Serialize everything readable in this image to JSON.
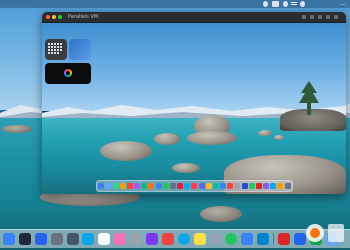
{
  "menubar": {
    "clock": "…",
    "status_icons": [
      "wifi-icon",
      "battery-icon",
      "search-icon",
      "control-center-icon",
      "siri-icon"
    ]
  },
  "window": {
    "title": "Parallels VM",
    "traffic_light_colors": [
      "#ff5f57",
      "#febc2e",
      "#28c840"
    ]
  },
  "widgets": [
    {
      "name": "calendar-widget"
    },
    {
      "name": "photos-widget"
    },
    {
      "name": "phone-widget"
    }
  ],
  "inner_dock": {
    "icon_colors": [
      "#3b82f6",
      "#60a5fa",
      "#34d399",
      "#f59e0b",
      "#ef4444",
      "#a855f7",
      "#10b981",
      "#f97316",
      "#3b82f6",
      "#22c55e",
      "#64748b",
      "#e11d48",
      "#0ea5e9",
      "#f43f5e",
      "#6366f1",
      "#fbbf24",
      "#14b8a6",
      "#3b82f6",
      "#ef4444",
      "#a3a3a3",
      "#1d4ed8",
      "#22c55e",
      "#dc2626",
      "#8b5cf6",
      "#0ea5e9",
      "#f59e0b",
      "#64748b"
    ]
  },
  "dock": {
    "apps": [
      {
        "name": "finder-icon",
        "color": "#3b82f6"
      },
      {
        "name": "terminal-icon",
        "color": "#1f2937"
      },
      {
        "name": "activity-icon",
        "color": "#2563eb"
      },
      {
        "name": "launchpad-icon",
        "color": "#6b7280"
      },
      {
        "name": "preview-icon",
        "color": "#475569"
      },
      {
        "name": "mail-icon",
        "color": "#0ea5e9"
      },
      {
        "name": "calendar-icon",
        "color": "#f8fafc"
      },
      {
        "name": "photos-icon",
        "color": "#f472b6"
      },
      {
        "name": "settings-icon",
        "color": "#9ca3af"
      },
      {
        "name": "podcasts-icon",
        "color": "#7c3aed"
      },
      {
        "name": "music-icon",
        "color": "#ef4444"
      },
      {
        "name": "safari-icon",
        "color": "#0ea5e9"
      },
      {
        "name": "notes-icon",
        "color": "#fde047"
      },
      {
        "name": "system-prefs-icon",
        "color": "#94a3b8"
      },
      {
        "name": "chrome-icon",
        "color": "#22c55e"
      },
      {
        "name": "app-store-icon",
        "color": "#3b82f6"
      },
      {
        "name": "vscode-icon",
        "color": "#0284c7"
      },
      {
        "name": "parallels-icon",
        "color": "#dc2626"
      },
      {
        "name": "word-icon",
        "color": "#2563eb"
      },
      {
        "name": "excel-icon",
        "color": "#16a34a"
      },
      {
        "name": "downloads-icon",
        "color": "#60a5fa"
      }
    ]
  },
  "colors": {
    "accent": "#1a8fa3"
  }
}
